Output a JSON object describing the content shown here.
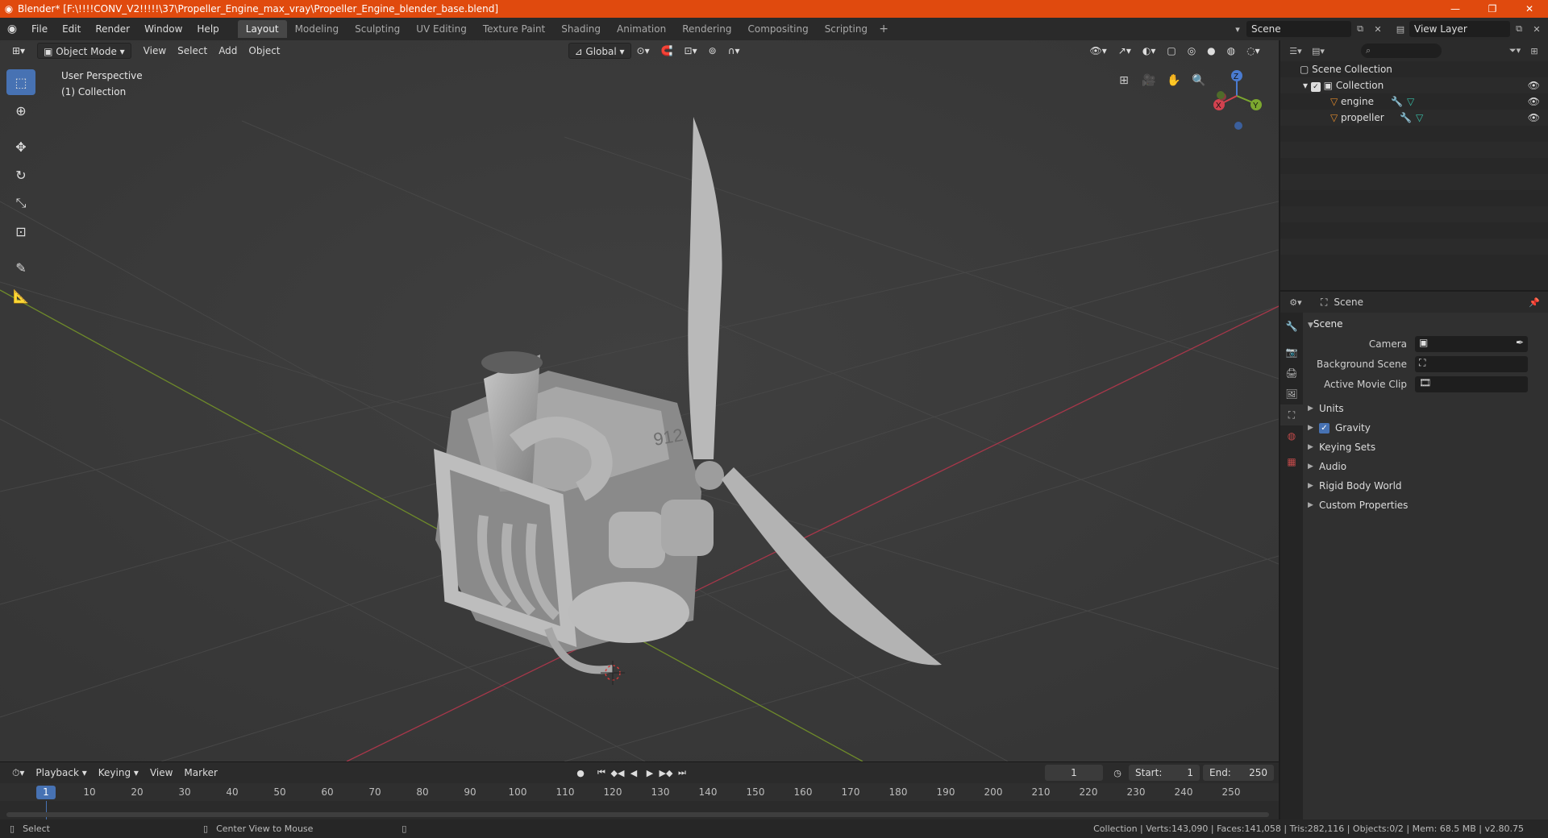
{
  "window": {
    "title": "Blender* [F:\\!!!!CONV_V2!!!!!\\37\\Propeller_Engine_max_vray\\Propeller_Engine_blender_base.blend]",
    "controls": [
      "—",
      "❐",
      "✕"
    ]
  },
  "menus": [
    "File",
    "Edit",
    "Render",
    "Window",
    "Help"
  ],
  "workspaces": [
    {
      "label": "Layout",
      "active": true
    },
    {
      "label": "Modeling"
    },
    {
      "label": "Sculpting"
    },
    {
      "label": "UV Editing"
    },
    {
      "label": "Texture Paint"
    },
    {
      "label": "Shading"
    },
    {
      "label": "Animation"
    },
    {
      "label": "Rendering"
    },
    {
      "label": "Compositing"
    },
    {
      "label": "Scripting"
    }
  ],
  "topbar": {
    "scene": "Scene",
    "view_layer": "View Layer"
  },
  "viewport": {
    "mode": "Object Mode",
    "menus": [
      "View",
      "Select",
      "Add",
      "Object"
    ],
    "orientation": "Global",
    "info_line1": "User Perspective",
    "info_line2": "(1) Collection",
    "engine_label": "912",
    "gizmo": {
      "z": "Z",
      "y": "Y",
      "x": "X"
    }
  },
  "outliner": {
    "root": "Scene Collection",
    "collection": "Collection",
    "objects": [
      "engine",
      "propeller"
    ]
  },
  "properties": {
    "header": "Scene",
    "panel": "Scene",
    "fields": [
      {
        "label": "Camera"
      },
      {
        "label": "Background Scene"
      },
      {
        "label": "Active Movie Clip"
      }
    ],
    "subpanels": [
      {
        "label": "Units",
        "check": false
      },
      {
        "label": "Gravity",
        "check": true
      },
      {
        "label": "Keying Sets",
        "check": false
      },
      {
        "label": "Audio",
        "check": false
      },
      {
        "label": "Rigid Body World",
        "check": false
      },
      {
        "label": "Custom Properties",
        "check": false
      }
    ]
  },
  "timeline": {
    "menus": [
      "Playback",
      "Keying",
      "View",
      "Marker"
    ],
    "current_frame": "1",
    "start_label": "Start:",
    "start": "1",
    "end_label": "End:",
    "end": "250",
    "ticks": [
      "10",
      "20",
      "30",
      "40",
      "50",
      "60",
      "70",
      "80",
      "90",
      "100",
      "110",
      "120",
      "130",
      "140",
      "150",
      "160",
      "170",
      "180",
      "190",
      "200",
      "210",
      "220",
      "230",
      "240",
      "250"
    ],
    "marker_label": "1"
  },
  "status": {
    "left": "Select",
    "middle": "Center View to Mouse",
    "right": "Collection | Verts:143,090 | Faces:141,058 | Tris:282,116 | Objects:0/2 | Mem: 68.5 MB | v2.80.75"
  }
}
